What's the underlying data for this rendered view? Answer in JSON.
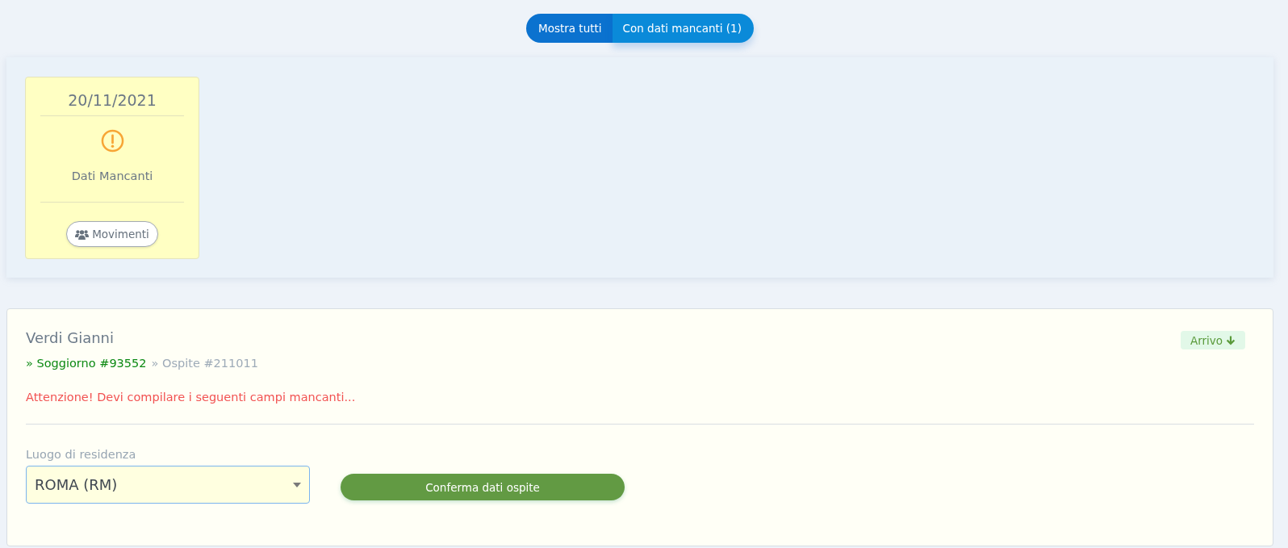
{
  "filter": {
    "options": [
      {
        "label": "Mostra tutti",
        "selected": false
      },
      {
        "label": "Con dati mancanti (1)",
        "selected": true
      }
    ]
  },
  "calendar": {
    "days": [
      {
        "date": "20/11/2021",
        "status": "Dati Mancanti",
        "button": "Movimenti"
      }
    ]
  },
  "guest": {
    "name": "Verdi Gianni",
    "stay": "» Soggiorno #93552",
    "guest_number": "» Ospite #211011",
    "badge": "Arrivo",
    "warning": "Attenzione! Devi compilare i seguenti campi mancanti...",
    "fields": [
      {
        "label": "Luogo di residenza",
        "value": "ROMA (RM)"
      }
    ],
    "submit": "Conferma dati ospite"
  }
}
